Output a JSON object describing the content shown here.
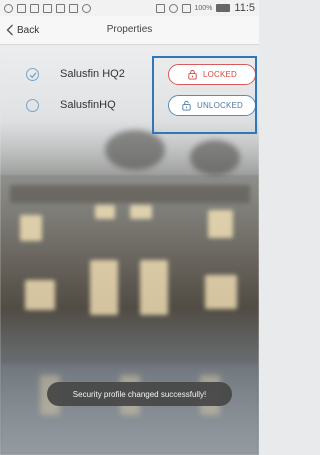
{
  "status_bar": {
    "battery_percent": "100%",
    "time": "11:5"
  },
  "nav": {
    "back_label": "Back",
    "title": "Properties"
  },
  "properties": [
    {
      "name": "Salusfin HQ2",
      "selected": true,
      "lock_label": "LOCKED",
      "lock_state": "locked",
      "color": "#d04848"
    },
    {
      "name": "SalusfinHQ",
      "selected": false,
      "lock_label": "UNLOCKED",
      "lock_state": "unlocked",
      "color": "#4f7aa3"
    }
  ],
  "toast": {
    "message": "Security profile changed successfully!"
  },
  "colors": {
    "highlight": "#2f78b7",
    "locked": "#d04848",
    "unlocked": "#4f7aa3",
    "radio": "#7aa5c9"
  }
}
